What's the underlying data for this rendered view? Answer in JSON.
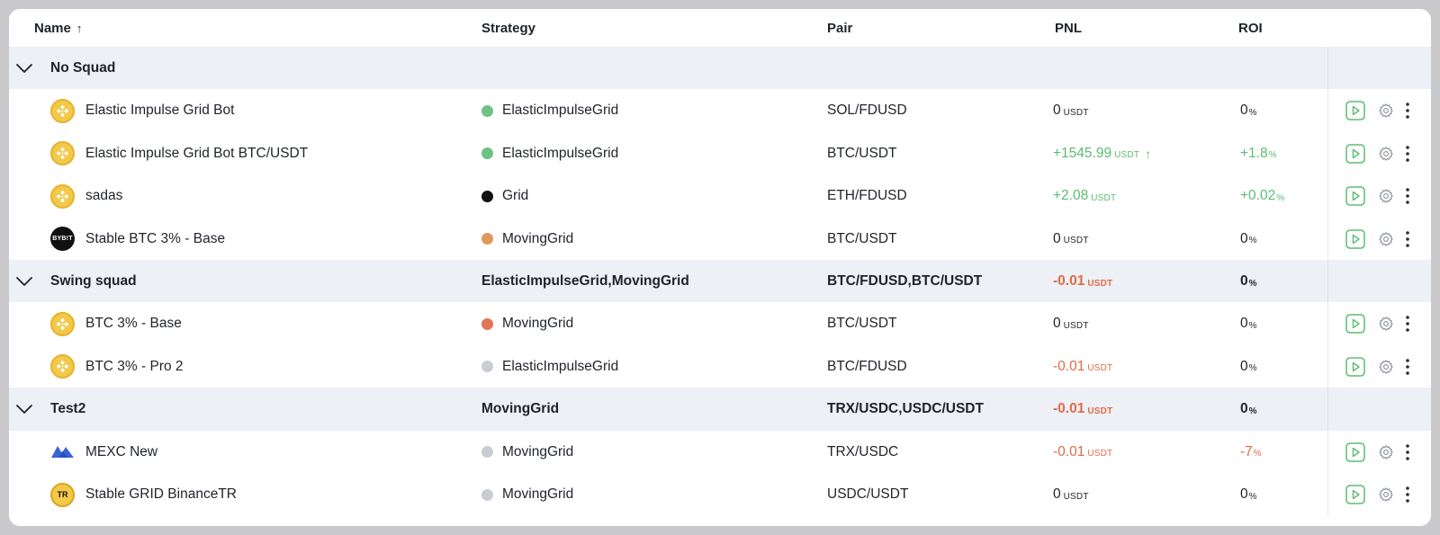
{
  "header": {
    "name": "Name",
    "sort_arrow": "↑",
    "strategy": "Strategy",
    "pair": "Pair",
    "pnl": "PNL",
    "roi": "ROI"
  },
  "colors": {
    "positive": "#5bbd70",
    "negative": "#e16a4a",
    "group_bg": "#edf0f4",
    "play_green": "#5bbd70"
  },
  "groups": [
    {
      "name": "No Squad",
      "strategy": "",
      "pair": "",
      "pnl": "",
      "pnl_unit": "",
      "roi": "",
      "roi_unit": "",
      "bots": [
        {
          "exchange_icon": "binance-icon",
          "name": "Elastic Impulse Grid Bot",
          "strategy_color": "#6cc383",
          "strategy": "ElasticImpulseGrid",
          "pair": "SOL/FDUSD",
          "pnl": "0",
          "pnl_unit": "USDT",
          "pnl_trend": "",
          "roi": "0",
          "roi_unit": "%"
        },
        {
          "exchange_icon": "binance-icon",
          "name": "Elastic Impulse Grid Bot BTC/USDT",
          "strategy_color": "#6cc383",
          "strategy": "ElasticImpulseGrid",
          "pair": "BTC/USDT",
          "pnl": "+1545.99",
          "pnl_unit": "USDT",
          "pnl_trend": "↑",
          "roi": "+1.8",
          "roi_unit": "%"
        },
        {
          "exchange_icon": "binance-icon",
          "name": "sadas",
          "strategy_color": "#111111",
          "strategy": "Grid",
          "pair": "ETH/FDUSD",
          "pnl": "+2.08",
          "pnl_unit": "USDT",
          "pnl_trend": "",
          "roi": "+0.02",
          "roi_unit": "%"
        },
        {
          "exchange_icon": "bybit-icon",
          "exchange_text": "BYB!T",
          "name": "Stable BTC 3% - Base",
          "strategy_color": "#e0975a",
          "strategy": "MovingGrid",
          "pair": "BTC/USDT",
          "pnl": "0",
          "pnl_unit": "USDT",
          "pnl_trend": "",
          "roi": "0",
          "roi_unit": "%"
        }
      ]
    },
    {
      "name": "Swing squad",
      "strategy": "ElasticImpulseGrid,MovingGrid",
      "pair": "BTC/FDUSD,BTC/USDT",
      "pnl": "-0.01",
      "pnl_unit": "USDT",
      "roi": "0",
      "roi_unit": "%",
      "bots": [
        {
          "exchange_icon": "binance-icon",
          "name": "BTC 3% - Base",
          "strategy_color": "#e07654",
          "strategy": "MovingGrid",
          "pair": "BTC/USDT",
          "pnl": "0",
          "pnl_unit": "USDT",
          "pnl_trend": "",
          "roi": "0",
          "roi_unit": "%"
        },
        {
          "exchange_icon": "binance-icon",
          "name": "BTC 3% - Pro 2",
          "strategy_color": "#c9ccd3",
          "strategy": "ElasticImpulseGrid",
          "pair": "BTC/FDUSD",
          "pnl": "-0.01",
          "pnl_unit": "USDT",
          "pnl_trend": "",
          "roi": "0",
          "roi_unit": "%"
        }
      ]
    },
    {
      "name": "Test2",
      "strategy": "MovingGrid",
      "pair": "TRX/USDC,USDC/USDT",
      "pnl": "-0.01",
      "pnl_unit": "USDT",
      "roi": "0",
      "roi_unit": "%",
      "bots": [
        {
          "exchange_icon": "mexc-icon",
          "name": "MEXC New",
          "strategy_color": "#c9ccd3",
          "strategy": "MovingGrid",
          "pair": "TRX/USDC",
          "pnl": "-0.01",
          "pnl_unit": "USDT",
          "pnl_trend": "",
          "roi": "-7",
          "roi_unit": "%"
        },
        {
          "exchange_icon": "binance-tr-icon",
          "exchange_text": "TR",
          "name": "Stable GRID BinanceTR",
          "strategy_color": "#c9ccd3",
          "strategy": "MovingGrid",
          "pair": "USDC/USDT",
          "pnl": "0",
          "pnl_unit": "USDT",
          "pnl_trend": "",
          "roi": "0",
          "roi_unit": "%"
        }
      ]
    }
  ]
}
